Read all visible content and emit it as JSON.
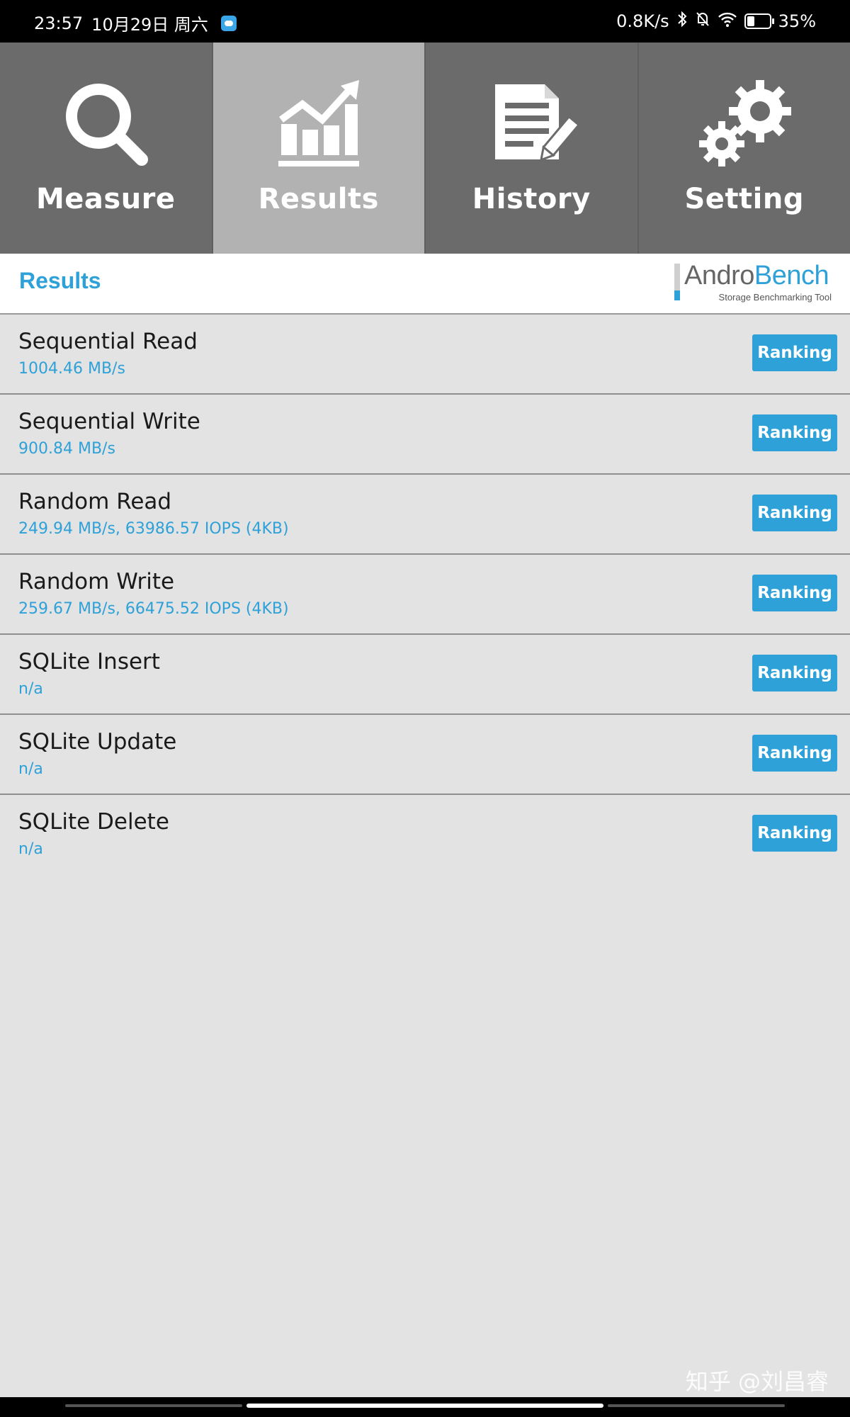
{
  "status_bar": {
    "time": "23:57",
    "date": "10月29日 周六",
    "net_speed": "0.8K/s",
    "battery": "35%",
    "battery_level": 0.35
  },
  "tabs": [
    {
      "label": "Measure",
      "icon": "magnifier-icon",
      "active": false
    },
    {
      "label": "Results",
      "icon": "chart-icon",
      "active": true
    },
    {
      "label": "History",
      "icon": "document-pen-icon",
      "active": false
    },
    {
      "label": "Setting",
      "icon": "gears-icon",
      "active": false
    }
  ],
  "header": {
    "title": "Results",
    "logo_part1": "Andro",
    "logo_part2": "Bench",
    "logo_tagline": "Storage Benchmarking Tool"
  },
  "results": [
    {
      "name": "Sequential Read",
      "value": "1004.46 MB/s",
      "button": "Ranking"
    },
    {
      "name": "Sequential Write",
      "value": "900.84 MB/s",
      "button": "Ranking"
    },
    {
      "name": "Random Read",
      "value": "249.94 MB/s, 63986.57 IOPS (4KB)",
      "button": "Ranking"
    },
    {
      "name": "Random Write",
      "value": "259.67 MB/s, 66475.52 IOPS (4KB)",
      "button": "Ranking"
    },
    {
      "name": "SQLite Insert",
      "value": "n/a",
      "button": "Ranking"
    },
    {
      "name": "SQLite Update",
      "value": "n/a",
      "button": "Ranking"
    },
    {
      "name": "SQLite Delete",
      "value": "n/a",
      "button": "Ranking"
    }
  ],
  "watermark": "知乎 @刘昌睿",
  "colors": {
    "accent": "#2ea1d8",
    "tab_bg": "#6b6b6b",
    "tab_active_bg": "#b2b2b2",
    "row_bg": "#e3e3e3"
  }
}
